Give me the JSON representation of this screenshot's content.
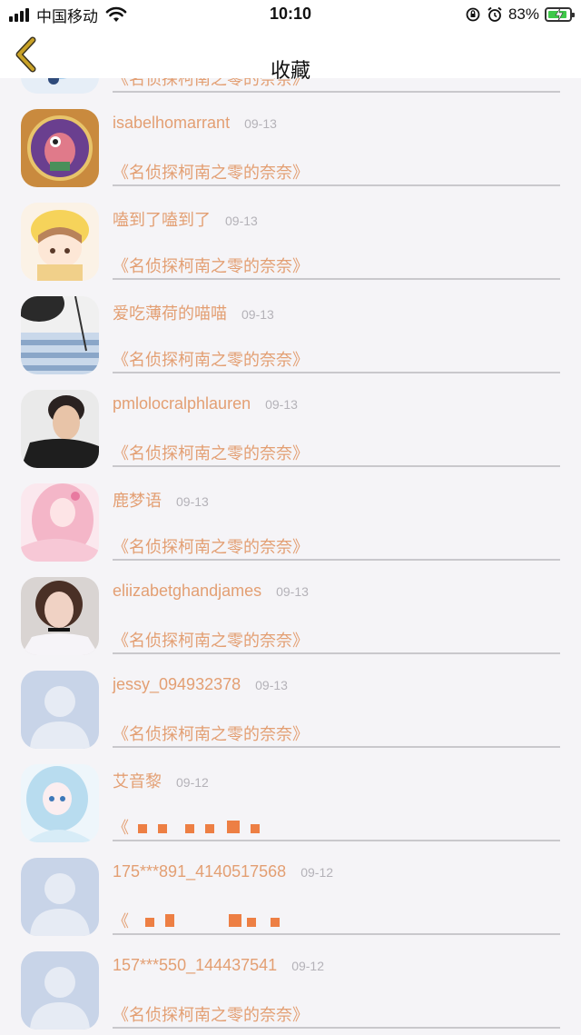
{
  "status_bar": {
    "carrier": "中国移动",
    "time": "10:10",
    "battery_percent": "83%"
  },
  "header": {
    "title": "收藏",
    "back_icon": "chevron-left-icon"
  },
  "colors": {
    "accent": "#e39f73",
    "date": "#b4b2b8",
    "back_arrow": "#c9a227",
    "divider": "#c9c8cc"
  },
  "favorites": [
    {
      "username": "",
      "date": "",
      "title": "《名侦探柯南之零的奈奈》",
      "avatar": "cartoon-avatar"
    },
    {
      "username": "isabelhomarrant",
      "date": "09-13",
      "title": "《名侦探柯南之零的奈奈》",
      "avatar": "cartoon-avatar"
    },
    {
      "username": "嗑到了嗑到了",
      "date": "09-13",
      "title": "《名侦探柯南之零的奈奈》",
      "avatar": "anime-avatar"
    },
    {
      "username": "爱吃薄荷的喵喵",
      "date": "09-13",
      "title": "《名侦探柯南之零的奈奈》",
      "avatar": "photo-avatar"
    },
    {
      "username": "pmlolocralphlauren",
      "date": "09-13",
      "title": "《名侦探柯南之零的奈奈》",
      "avatar": "photo-avatar"
    },
    {
      "username": "鹿梦语",
      "date": "09-13",
      "title": "《名侦探柯南之零的奈奈》",
      "avatar": "anime-avatar"
    },
    {
      "username": "eliizabetghandjames",
      "date": "09-13",
      "title": "《名侦探柯南之零的奈奈》",
      "avatar": "photo-avatar"
    },
    {
      "username": "jessy_094932378",
      "date": "09-13",
      "title": "《名侦探柯南之零的奈奈》",
      "avatar": "default-avatar"
    },
    {
      "username": "艾音黎",
      "date": "09-12",
      "title": "《",
      "avatar": "anime-avatar",
      "pixelated": true
    },
    {
      "username": "175***891_4140517568",
      "date": "09-12",
      "title": "《",
      "avatar": "default-avatar",
      "pixelated": true
    },
    {
      "username": "157***550_144437541",
      "date": "09-12",
      "title": "《名侦探柯南之零的奈奈》",
      "avatar": "default-avatar"
    }
  ]
}
